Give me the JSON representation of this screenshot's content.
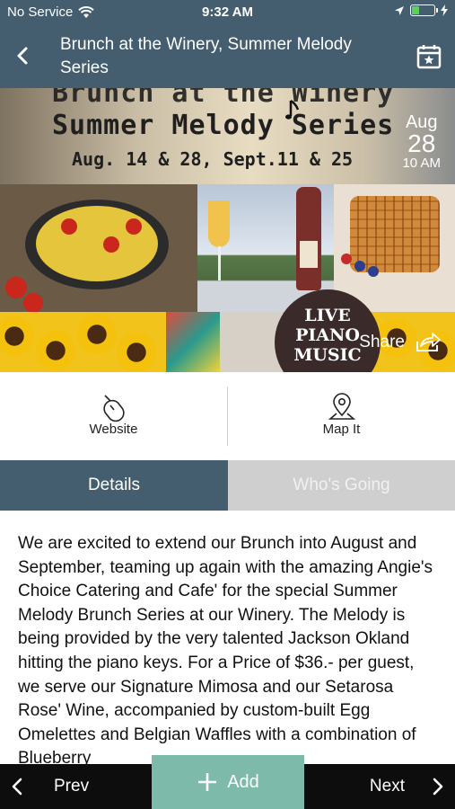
{
  "status_bar": {
    "carrier": "No Service",
    "time": "9:32 AM"
  },
  "nav": {
    "title": "Brunch at the Winery, Summer Melody Series"
  },
  "banner": {
    "line1": "Brunch at the Winery",
    "line2": "Summer Melody Series",
    "line3": "Aug. 14 & 28, Sept.11 & 25",
    "date_month": "Aug",
    "date_day": "28",
    "date_time": "10 AM",
    "piano_text": "LIVE PIANO MUSIC",
    "share_label": "Share"
  },
  "actions": {
    "website_label": "Website",
    "mapit_label": "Map It"
  },
  "tabs": {
    "details": "Details",
    "whos_going": "Who's Going"
  },
  "content": {
    "description": "We are excited to extend our Brunch into August and September, teaming up again with the amazing Angie's Choice Catering and Cafe' for the special Summer Melody Brunch Series at our Winery. The Melody is being provided by the very talented Jackson Okland hitting the piano keys. For a Price of $36.- per guest, we serve our Signature Mimosa and our Setarosa Rose' Wine, accompanied by custom-built Egg Omelettes and Belgian Waffles with a combination of Blueberry"
  },
  "bottom_bar": {
    "prev_label": "Prev",
    "add_label": "Add",
    "next_label": "Next"
  },
  "colors": {
    "header": "#445e6f",
    "tab_inactive": "#cfcfcf",
    "add_button": "#7dbaaa",
    "bottom_bar": "#0d0d0d"
  }
}
